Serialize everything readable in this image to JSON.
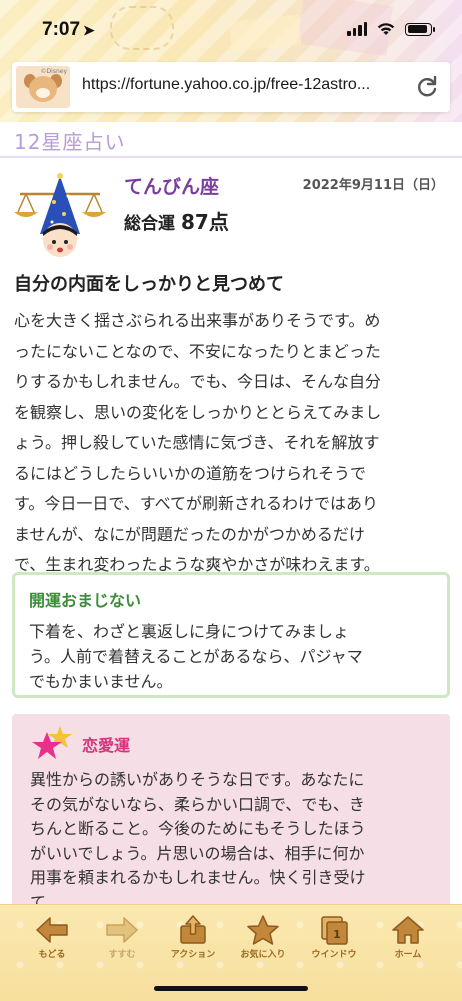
{
  "status_bar": {
    "time": "7:07"
  },
  "browser": {
    "url": "https://fortune.yahoo.co.jp/free-12astro...",
    "favicon_label": "©Disney"
  },
  "page": {
    "title": "12星座占い",
    "sign": "てんびん座",
    "date": "2022年9月11日（日）",
    "score_label": "総合運",
    "score_value": "87点",
    "headline": "自分の内面をしっかりと見つめて",
    "body_lines": [
      "心を大きく揺さぶられる出来事がありそうです。め",
      "ったにないことなので、不安になったりとまどった",
      "りするかもしれません。でも、今日は、そんな自分",
      "を観察し、思いの変化をしっかりととらえてみまし",
      "ょう。押し殺していた感情に気づき、それを解放す",
      "るにはどうしたらいいかの道筋をつけられそうで",
      "す。今日一日で、すべてが刷新されるわけではあり",
      "ませんが、なにが問題だったのかがつかめるだけ",
      "で、生まれ変わったような爽やかさが味わえます。"
    ]
  },
  "luck_charm": {
    "title": "開運おまじない",
    "lines": [
      "下着を、わざと裏返しに身につけてみましょ",
      "う。人前で着替えることがあるなら、パジャマ",
      "でもかまいません。"
    ]
  },
  "love": {
    "title": "恋愛運",
    "lines": [
      "異性からの誘いがありそうな日です。あなたに",
      "その気がないなら、柔らかい口調で、でも、き",
      "ちんと断ること。今後のためにもそうしたほう",
      "がいいでしょう。片思いの場合は、相手に何か",
      "用事を頼まれるかもしれません。快く引き受け",
      "て。"
    ]
  },
  "toolbar": {
    "back": "もどる",
    "forward": "すすむ",
    "action": "アクション",
    "favorites": "お気に入り",
    "window": "ウインドウ",
    "window_count": "1",
    "home": "ホーム"
  },
  "colors": {
    "sign_name": "#7a3f9d",
    "page_title": "#b99bd8",
    "luck_title": "#3d8c3a",
    "love_title": "#d6347b",
    "love_bg": "#f6dee6",
    "toolbar_bg": "#f7df9e"
  }
}
